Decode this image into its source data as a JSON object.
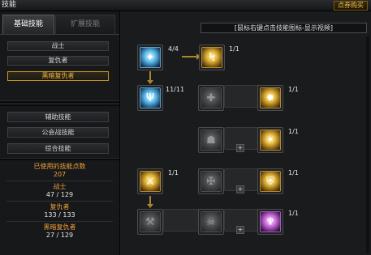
{
  "window": {
    "title": "技能",
    "shop_button": "点券购买"
  },
  "tabs": [
    {
      "label": "基础技能",
      "active": true
    },
    {
      "label": "扩展技能",
      "active": false
    }
  ],
  "categories": [
    {
      "label": "战士",
      "selected": false
    },
    {
      "label": "复仇者",
      "selected": false
    },
    {
      "label": "黑暗复仇者",
      "selected": true
    }
  ],
  "other_categories": [
    {
      "label": "辅助技能"
    },
    {
      "label": "公会战技能"
    },
    {
      "label": "综合技能"
    }
  ],
  "stats": {
    "used_points_label": "已使用的技能点数",
    "used_points_value": "207",
    "classes": [
      {
        "name": "战士",
        "value": "47 / 129"
      },
      {
        "name": "复仇者",
        "value": "133 / 133"
      },
      {
        "name": "黑暗复仇者",
        "value": "27 / 129"
      }
    ]
  },
  "hint": "[鼠标右键点击技能图标-显示视频]",
  "skills": [
    {
      "id": "r1c1",
      "icon": "blue-crest-skill-icon",
      "color": "blue",
      "glyph": "✦",
      "level": "4/4"
    },
    {
      "id": "r1c2",
      "icon": "gold-rune-skill-icon",
      "color": "gold",
      "glyph": "Ϟ",
      "level": "1/1"
    },
    {
      "id": "r2c1",
      "icon": "blue-fork-skill-icon",
      "color": "blue",
      "glyph": "Ψ",
      "level": "11/11"
    },
    {
      "id": "r2c2",
      "icon": "locked-skill-icon",
      "color": "gray",
      "glyph": "✚",
      "level": ""
    },
    {
      "id": "r2c3",
      "icon": "gold-burst-skill-icon",
      "color": "gold",
      "glyph": "✸",
      "level": "1/1"
    },
    {
      "id": "r3c2",
      "icon": "locked-skill-icon",
      "color": "gray",
      "glyph": "☗",
      "level": ""
    },
    {
      "id": "r3c3",
      "icon": "gold-sun-skill-icon",
      "color": "gold",
      "glyph": "☀",
      "level": "1/1"
    },
    {
      "id": "r4c1",
      "icon": "gold-blade-skill-icon",
      "color": "gold",
      "glyph": "⚔",
      "level": "1/1"
    },
    {
      "id": "r4c2",
      "icon": "locked-skill-icon",
      "color": "gray",
      "glyph": "✠",
      "level": ""
    },
    {
      "id": "r4c3",
      "icon": "gold-shield-skill-icon",
      "color": "gold",
      "glyph": "⛨",
      "level": "1/1"
    },
    {
      "id": "r5c1",
      "icon": "locked-skill-icon",
      "color": "gray",
      "glyph": "⚒",
      "level": ""
    },
    {
      "id": "r5c2",
      "icon": "locked-skill-icon",
      "color": "gray",
      "glyph": "☠",
      "level": ""
    },
    {
      "id": "r5c3",
      "icon": "purple-spirit-skill-icon",
      "color": "purple",
      "glyph": "♆",
      "level": "1/1"
    }
  ],
  "plus_symbol": "+"
}
